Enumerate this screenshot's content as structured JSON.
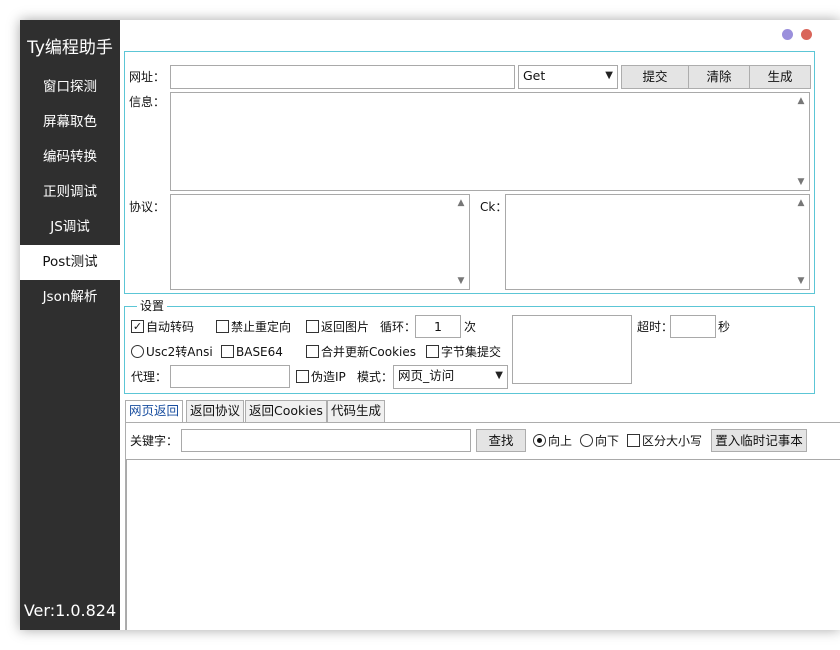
{
  "app": {
    "title": "Ty编程助手",
    "version": "Ver:1.0.824"
  },
  "sidebar": {
    "items": [
      {
        "label": "窗口探测"
      },
      {
        "label": "屏幕取色"
      },
      {
        "label": "编码转换"
      },
      {
        "label": "正则调试"
      },
      {
        "label": "JS调试"
      },
      {
        "label": "Post测试"
      },
      {
        "label": "Json解析"
      }
    ],
    "active": "Post测试"
  },
  "window_controls": {
    "minimize_color": "#9a8fdc",
    "close_color": "#d9655a"
  },
  "request": {
    "url_label": "网址：",
    "url_value": "",
    "method": "Get",
    "submit": "提交",
    "clear": "清除",
    "generate": "生成",
    "info_label": "信息：",
    "protocol_label": "协议：",
    "ck_label": "Ck："
  },
  "settings": {
    "title": "设置",
    "auto_transcode": "自动转码",
    "no_redirect": "禁止重定向",
    "return_image": "返回图片",
    "loop_label": "循环：",
    "loop_value": "1",
    "loop_unit": "次",
    "timeout_label": "超时：",
    "timeout_value": "",
    "timeout_unit": "秒",
    "usc2_ansi": "Usc2转Ansi",
    "base64": "BASE64",
    "merge_cookies": "合并更新Cookies",
    "byte_submit": "字节集提交",
    "proxy_label": "代理：",
    "proxy_value": "",
    "fake_ip": "伪造IP",
    "mode_label": "模式：",
    "mode_value": "网页_访问"
  },
  "result": {
    "tabs": [
      "网页返回",
      "返回协议",
      "返回Cookies",
      "代码生成"
    ],
    "active_tab": "网页返回",
    "keyword_label": "关键字：",
    "keyword_value": "",
    "find": "查找",
    "up": "向上",
    "down": "向下",
    "case_sensitive": "区分大小写",
    "notepad": "置入临时记事本"
  }
}
